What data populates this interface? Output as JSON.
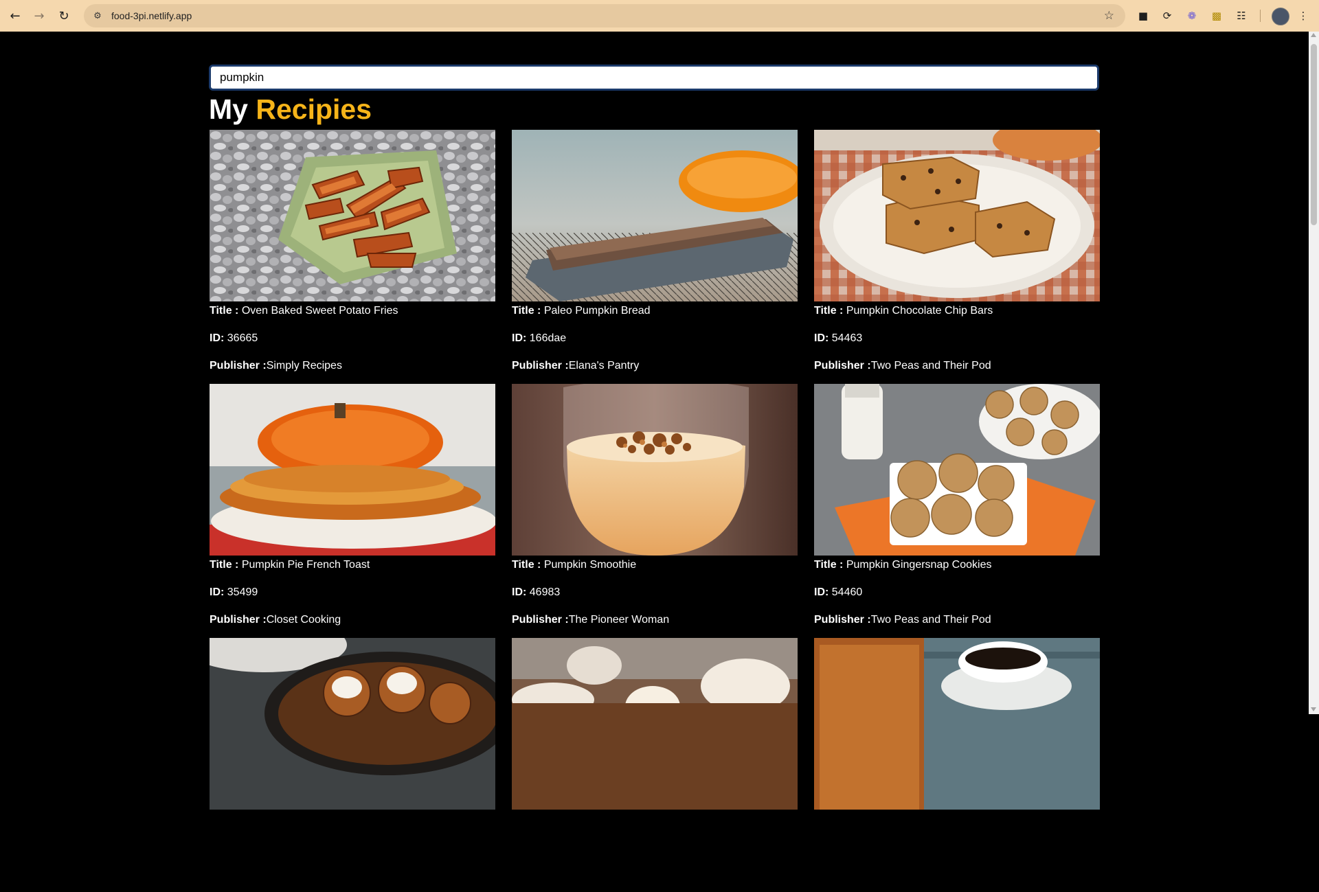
{
  "browser": {
    "url": "food-3pi.netlify.app",
    "back_icon": "arrow-left-icon",
    "forward_icon": "arrow-right-icon",
    "reload_icon": "reload-icon",
    "site_info_icon": "site-settings-icon",
    "bookmark_icon": "star-icon",
    "extensions": [
      "extension-icon",
      "extension-icon",
      "extension-icon",
      "extension-icon",
      "puzzle-icon"
    ],
    "menu_icon": "kebab-menu-icon"
  },
  "search": {
    "value": "pumpkin",
    "placeholder": ""
  },
  "header": {
    "title_plain": "My",
    "title_accent": "Recipies",
    "accent_color": "#f6b419"
  },
  "labels": {
    "title": "Title :",
    "id": "ID:",
    "publisher": "Publisher :"
  },
  "recipes": [
    {
      "title": " Oven Baked Sweet Potato Fries",
      "id": " 36665",
      "publisher": "Simply Recipes",
      "image": "sweet-potato-fries-photo"
    },
    {
      "title": " Paleo Pumpkin Bread",
      "id": " 166dae",
      "publisher": "Elana's Pantry",
      "image": "pumpkin-bread-photo"
    },
    {
      "title": " Pumpkin Chocolate Chip Bars",
      "id": " 54463",
      "publisher": "Two Peas and Their Pod",
      "image": "chocolate-chip-bars-photo"
    },
    {
      "title": " Pumpkin Pie French Toast",
      "id": " 35499",
      "publisher": "Closet Cooking",
      "image": "french-toast-photo"
    },
    {
      "title": " Pumpkin Smoothie",
      "id": " 46983",
      "publisher": "The Pioneer Woman",
      "image": "smoothie-photo"
    },
    {
      "title": " Pumpkin Gingersnap Cookies",
      "id": " 54460",
      "publisher": "Two Peas and Their Pod",
      "image": "gingersnap-cookies-photo"
    },
    {
      "image": "cinnamon-rolls-photo"
    },
    {
      "image": "cupcakes-photo"
    },
    {
      "image": "bread-and-coffee-photo"
    }
  ]
}
